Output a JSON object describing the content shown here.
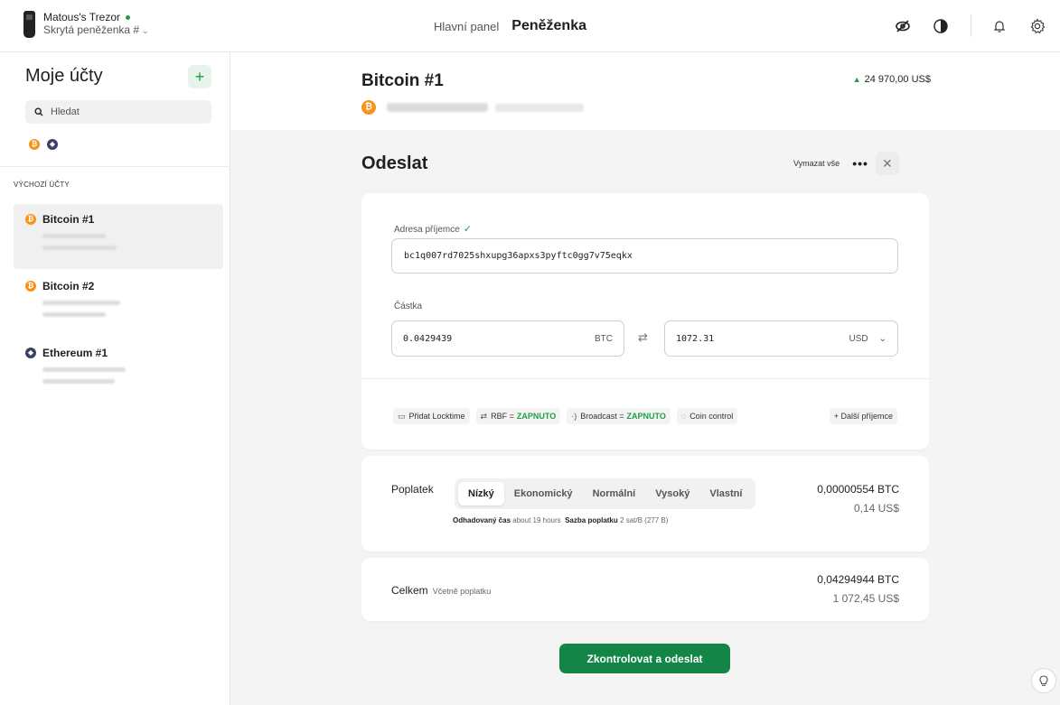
{
  "device": {
    "name": "Matous's Trezor",
    "wallet": "Skrytá peněženka #",
    "status_color": "#1e9e4a",
    "icon": "trezor-device-icon"
  },
  "nav": {
    "dashboard": "Hlavní panel",
    "wallet": "Peněženka",
    "active": "wallet"
  },
  "top_icons": [
    "eye-off-icon",
    "theme-contrast-icon",
    "bell-icon",
    "gear-icon"
  ],
  "sidebar": {
    "title": "Moje účty",
    "add_icon": "plus-icon",
    "search_placeholder": "Hledat",
    "coin_filters": [
      "bitcoin-icon",
      "ethereum-icon"
    ],
    "group_label": "VÝCHOZÍ ÚČTY",
    "accounts": [
      {
        "name": "Bitcoin #1",
        "coin": "btc",
        "selected": true
      },
      {
        "name": "Bitcoin #2",
        "coin": "btc",
        "selected": false
      },
      {
        "name": "Ethereum #1",
        "coin": "eth",
        "selected": false
      }
    ]
  },
  "account_header": {
    "title": "Bitcoin #1",
    "change": "24 970,00 US$",
    "change_color": "#1e9e4a",
    "balance_hidden": true
  },
  "send": {
    "title": "Odeslat",
    "clear_all": "Vymazat vše",
    "more": "•••",
    "close": "✕",
    "recipient_label": "Adresa příjemce",
    "address": "bc1q007rd7025shxupg36apxs3pyftc0gg7v75eqkx",
    "amount_label": "Částka",
    "amount_crypto": "0.0429439",
    "crypto_unit": "BTC",
    "amount_fiat": "1072.31",
    "fiat_unit": "USD",
    "options": {
      "locktime": "Přidat Locktime",
      "rbf": "RBF =",
      "rbf_value": "ZAPNUTO",
      "broadcast": "Broadcast =",
      "broadcast_value": "ZAPNUTO",
      "coin_control": "Coin control",
      "add_recipient": "+ Další příjemce"
    }
  },
  "fee": {
    "label": "Poplatek",
    "tabs": [
      "Nízký",
      "Ekonomický",
      "Normální",
      "Vysoký",
      "Vlastní"
    ],
    "active_tab": 0,
    "est_time_label": "Odhadovaný čas",
    "est_time_value": "about 19 hours",
    "rate_label": "Sazba poplatku",
    "rate_value": "2 sat/B",
    "rate_size": "(277 B)",
    "btc": "0,00000554 BTC",
    "usd": "0,14 US$"
  },
  "total": {
    "label": "Celkem",
    "sub": "Včetně poplatku",
    "btc": "0,04294944 BTC",
    "usd": "1 072,45 US$"
  },
  "submit_label": "Zkontrolovat a odeslat",
  "help_icon": "lightbulb-icon"
}
